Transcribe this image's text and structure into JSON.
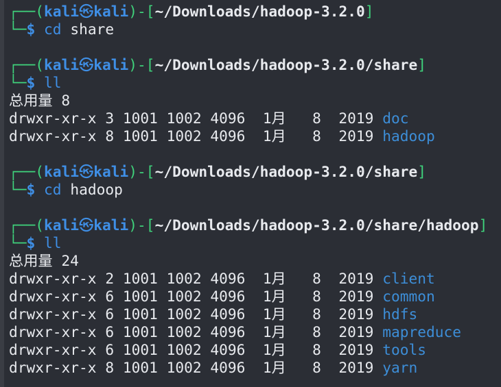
{
  "blocks": [
    {
      "prompt": {
        "open": "┌──(",
        "user": "kali",
        "at": "㉿",
        "host": "kali",
        "mid": ")-[",
        "path": "~/Downloads/hadoop-3.2.0",
        "close": "]"
      },
      "cmd": {
        "corner": "└─",
        "dollar": "$",
        "command": "cd",
        "arg": " share"
      },
      "output": []
    },
    {
      "prompt": {
        "open": "┌──(",
        "user": "kali",
        "at": "㉿",
        "host": "kali",
        "mid": ")-[",
        "path": "~/Downloads/hadoop-3.2.0/share",
        "close": "]"
      },
      "cmd": {
        "corner": "└─",
        "dollar": "$",
        "command": "ll",
        "arg": ""
      },
      "output": [
        {
          "text": "总用量 8"
        },
        {
          "text": "drwxr-xr-x 3 1001 1002 4096  1月   8  2019 ",
          "name": "doc"
        },
        {
          "text": "drwxr-xr-x 8 1001 1002 4096  1月   8  2019 ",
          "name": "hadoop"
        }
      ]
    },
    {
      "prompt": {
        "open": "┌──(",
        "user": "kali",
        "at": "㉿",
        "host": "kali",
        "mid": ")-[",
        "path": "~/Downloads/hadoop-3.2.0/share",
        "close": "]"
      },
      "cmd": {
        "corner": "└─",
        "dollar": "$",
        "command": "cd",
        "arg": " hadoop"
      },
      "output": []
    },
    {
      "prompt": {
        "open": "┌──(",
        "user": "kali",
        "at": "㉿",
        "host": "kali",
        "mid": ")-[",
        "path": "~/Downloads/hadoop-3.2.0/share/hadoop",
        "close": "]"
      },
      "cmd": {
        "corner": "└─",
        "dollar": "$",
        "command": "ll",
        "arg": ""
      },
      "output": [
        {
          "text": "总用量 24"
        },
        {
          "text": "drwxr-xr-x 2 1001 1002 4096  1月   8  2019 ",
          "name": "client"
        },
        {
          "text": "drwxr-xr-x 6 1001 1002 4096  1月   8  2019 ",
          "name": "common"
        },
        {
          "text": "drwxr-xr-x 6 1001 1002 4096  1月   8  2019 ",
          "name": "hdfs"
        },
        {
          "text": "drwxr-xr-x 6 1001 1002 4096  1月   8  2019 ",
          "name": "mapreduce"
        },
        {
          "text": "drwxr-xr-x 6 1001 1002 4096  1月   8  2019 ",
          "name": "tools"
        },
        {
          "text": "drwxr-xr-x 8 1001 1002 4096  1月   8  2019 ",
          "name": "yarn"
        }
      ]
    }
  ],
  "colors": {
    "background": "#2b2e35",
    "prompt_frame": "#3fd27b",
    "user_host": "#3f8fe6",
    "directory": "#3d8ed8",
    "text": "#e8eaee"
  }
}
